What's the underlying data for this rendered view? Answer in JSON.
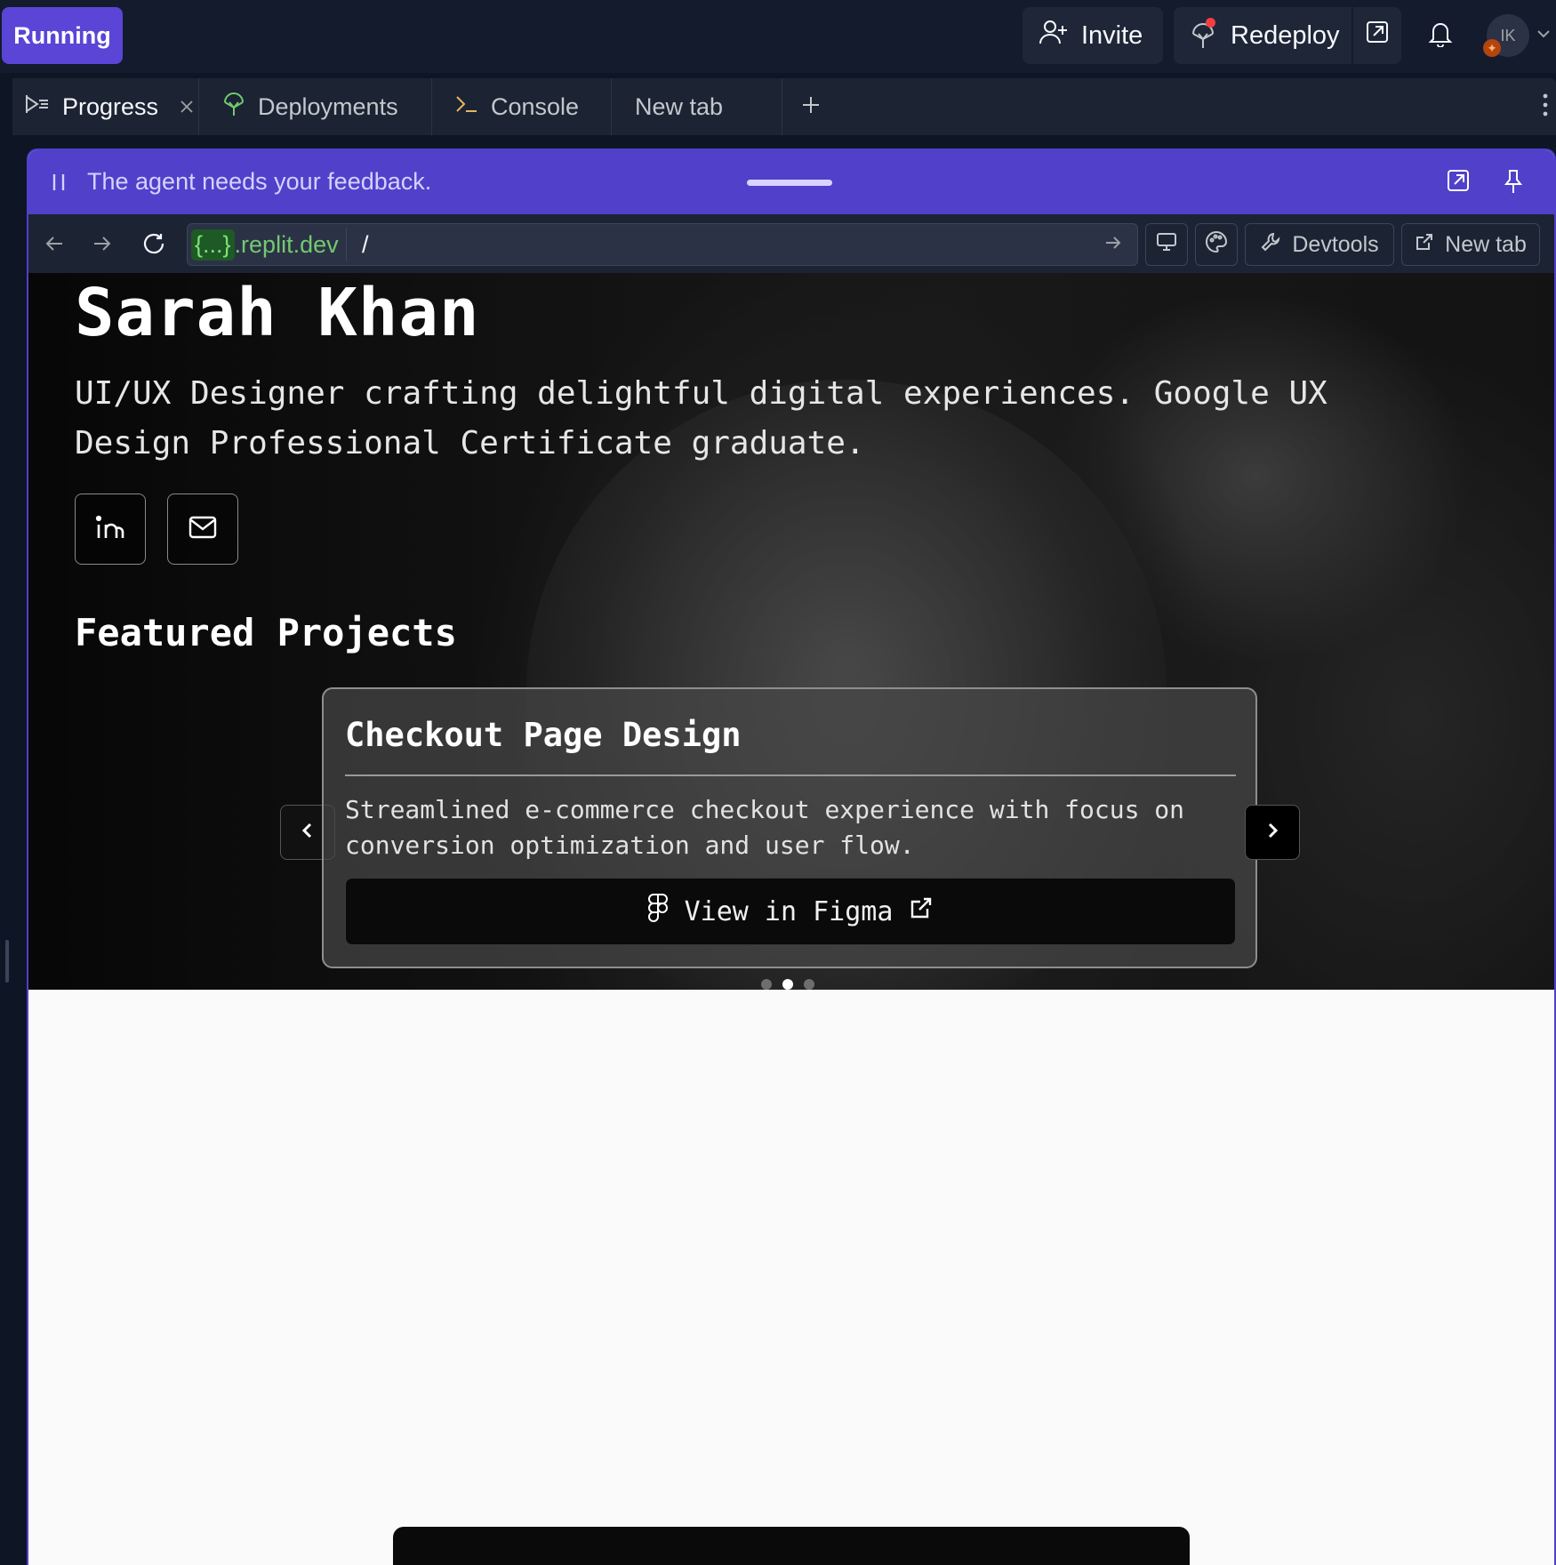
{
  "topbar": {
    "run_label": "Running",
    "invite_label": "Invite",
    "redeploy_label": "Redeploy",
    "avatar_initials": "IK"
  },
  "tabs": [
    {
      "label": "Progress",
      "icon": "progress-icon",
      "active": true
    },
    {
      "label": "Deployments",
      "icon": "deployments-icon"
    },
    {
      "label": "Console",
      "icon": "console-icon"
    },
    {
      "label": "New tab"
    }
  ],
  "feedback": {
    "message": "The agent needs your feedback."
  },
  "urlbar": {
    "host_braces": "{...}",
    "host_domain": ".replit.dev",
    "path": "/",
    "devtools_label": "Devtools",
    "newtab_label": "New tab"
  },
  "preview": {
    "name": "Sarah Khan",
    "bio": "UI/UX Designer crafting delightful digital experiences. Google UX Design Professional Certificate graduate.",
    "featured_title": "Featured Projects",
    "project": {
      "title": "Checkout Page Design",
      "description": "Streamlined e-commerce checkout experience with focus on conversion optimization and user flow.",
      "cta_label": "View in Figma"
    },
    "carousel": {
      "total": 3,
      "active_index": 1
    }
  },
  "colors": {
    "accent": "#5a45d6",
    "feedback_bar": "#5140c9",
    "url_host": "#73c96f",
    "background": "#0e1525"
  }
}
